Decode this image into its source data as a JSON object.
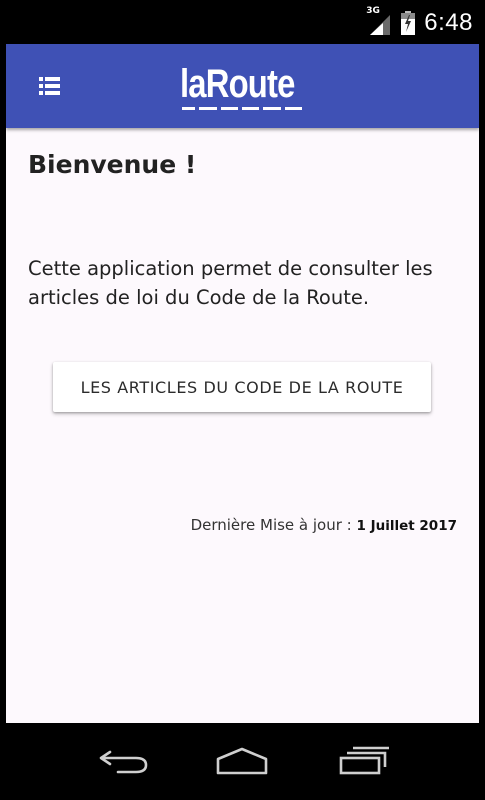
{
  "status_bar": {
    "network_type": "3G",
    "time": "6:48",
    "icons": [
      "signal-icon",
      "battery-icon"
    ]
  },
  "toolbar": {
    "menu_icon": "menu-list-icon",
    "logo_text": "laRoute",
    "background_color": "#3f51b5"
  },
  "main": {
    "title": "Bienvenue !",
    "intro": "Cette application permet de consulter les articles de loi du Code de la Route.",
    "articles_button_label": "LES ARTICLES DU CODE DE LA ROUTE",
    "update_label": "Dernière Mise à jour : ",
    "update_date": "1 Juillet 2017"
  },
  "nav_bar": {
    "icons": [
      "back-icon",
      "home-icon",
      "recent-apps-icon"
    ]
  }
}
